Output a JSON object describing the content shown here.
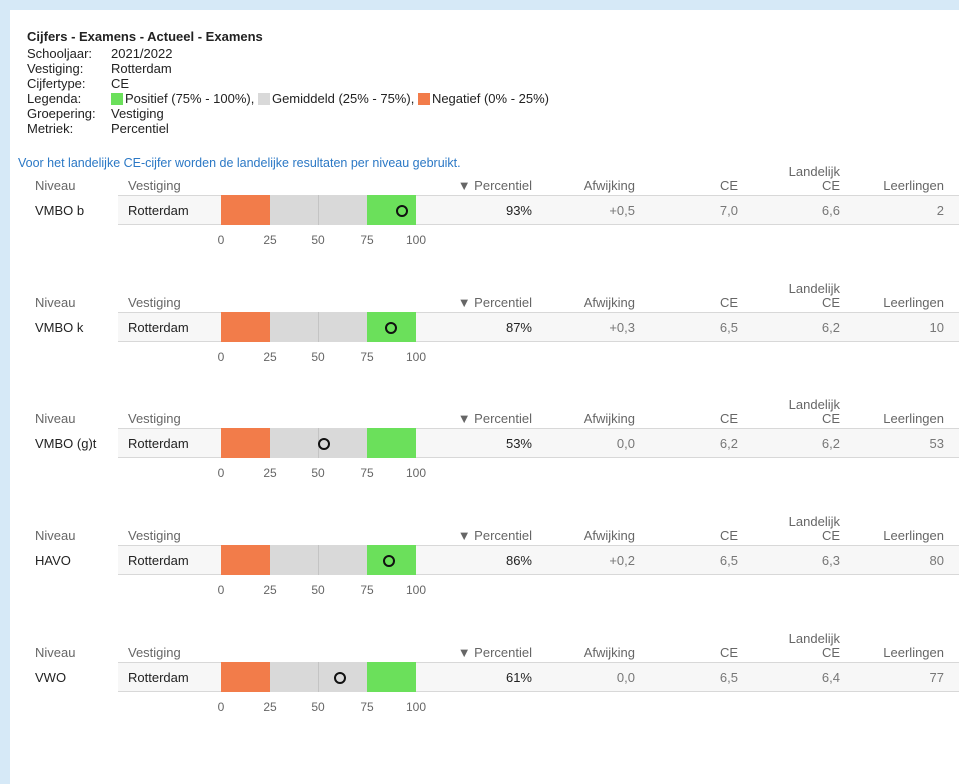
{
  "header": {
    "title": "Cijfers - Examens - Actueel - Examens",
    "schooljaar_label": "Schooljaar:",
    "schooljaar": "2021/2022",
    "vestiging_label": "Vestiging:",
    "vestiging": "Rotterdam",
    "cijfertype_label": "Cijfertype:",
    "cijfertype": "CE",
    "legenda_label": "Legenda:",
    "legend": [
      {
        "label": "Positief (75% - 100%),",
        "color": "#6be05b"
      },
      {
        "label": "Gemiddeld (25% - 75%),",
        "color": "#d9d9d9"
      },
      {
        "label": "Negatief (0% - 25%)",
        "color": "#f27c4a"
      }
    ],
    "groepering_label": "Groepering:",
    "groepering": "Vestiging",
    "metriek_label": "Metriek:",
    "metriek": "Percentiel",
    "note": "Voor het landelijke CE-cijfer worden de landelijke resultaten per niveau gebruikt."
  },
  "columns": {
    "niveau": "Niveau",
    "vestiging": "Vestiging",
    "percentiel": "▼ Percentiel",
    "afwijking": "Afwijking",
    "ce": "CE",
    "landelijk_line1": "Landelijk",
    "landelijk_line2": "CE",
    "leerlingen": "Leerlingen"
  },
  "axis_ticks": [
    "0",
    "25",
    "50",
    "75",
    "100"
  ],
  "rows": [
    {
      "niveau": "VMBO b",
      "vestiging": "Rotterdam",
      "percentiel": "93%",
      "percentiel_value": 93,
      "afwijking": "+0,5",
      "ce": "7,0",
      "landelijk_ce": "6,6",
      "leerlingen": "2"
    },
    {
      "niveau": "VMBO k",
      "vestiging": "Rotterdam",
      "percentiel": "87%",
      "percentiel_value": 87,
      "afwijking": "+0,3",
      "ce": "6,5",
      "landelijk_ce": "6,2",
      "leerlingen": "10"
    },
    {
      "niveau": "VMBO (g)t",
      "vestiging": "Rotterdam",
      "percentiel": "53%",
      "percentiel_value": 53,
      "afwijking": "0,0",
      "ce": "6,2",
      "landelijk_ce": "6,2",
      "leerlingen": "53"
    },
    {
      "niveau": "HAVO",
      "vestiging": "Rotterdam",
      "percentiel": "86%",
      "percentiel_value": 86,
      "afwijking": "+0,2",
      "ce": "6,5",
      "landelijk_ce": "6,3",
      "leerlingen": "80"
    },
    {
      "niveau": "VWO",
      "vestiging": "Rotterdam",
      "percentiel": "61%",
      "percentiel_value": 61,
      "afwijking": "0,0",
      "ce": "6,5",
      "landelijk_ce": "6,4",
      "leerlingen": "77"
    }
  ]
}
